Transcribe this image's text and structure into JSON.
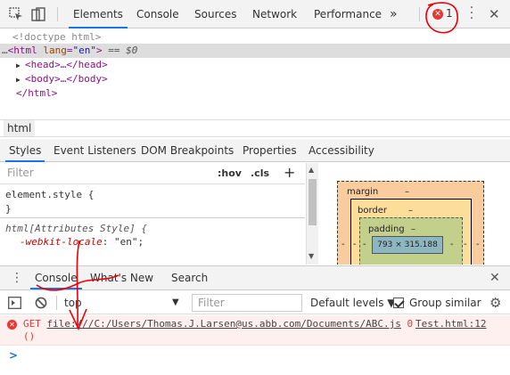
{
  "toolbar": {
    "tabs": [
      {
        "label": "Elements",
        "active": true
      },
      {
        "label": "Console",
        "active": false
      },
      {
        "label": "Sources",
        "active": false
      },
      {
        "label": "Network",
        "active": false
      },
      {
        "label": "Performance",
        "active": false
      }
    ],
    "overflow_label": "»",
    "error_count": "1",
    "icons": [
      "inspect-icon",
      "device-toolbar-icon",
      "more-tabs-icon",
      "error-icon",
      "kebab-menu-icon",
      "close-icon"
    ]
  },
  "dom": {
    "doctype": "<!doctype html>",
    "html_open_tag": "html",
    "html_attr_name": "lang",
    "html_attr_value": "\"en\"",
    "selected_suffix": "== $0",
    "head_line": "<head>…</head>",
    "body_line": "<body>…</body>",
    "html_close": "</html>"
  },
  "breadcrumb": {
    "item": "html"
  },
  "styles_tabs": [
    {
      "label": "Styles",
      "active": true
    },
    {
      "label": "Event Listeners",
      "active": false
    },
    {
      "label": "DOM Breakpoints",
      "active": false
    },
    {
      "label": "Properties",
      "active": false
    },
    {
      "label": "Accessibility",
      "active": false
    }
  ],
  "styles_filter": {
    "placeholder": "Filter",
    "hov": ":hov",
    "cls": ".cls",
    "add": "+"
  },
  "rules": {
    "element_style_open": "element.style {",
    "element_style_close": "}",
    "attr_selector": "html[Attributes Style] {",
    "prop_name": "-webkit-locale",
    "prop_value": ": \"en\";"
  },
  "box_model": {
    "margin_label": "margin",
    "margin_value": "–",
    "border_label": "border",
    "border_value": "–",
    "padding_label": "padding",
    "padding_value": "–",
    "content_size": "793 × 315.188",
    "side_dash": "-"
  },
  "drawer": {
    "tabs": [
      {
        "label": "Console",
        "active": true
      },
      {
        "label": "What's New",
        "active": false
      },
      {
        "label": "Search",
        "active": false
      }
    ],
    "close": "✕"
  },
  "console_bar": {
    "context": "top",
    "filter_placeholder": "Filter",
    "levels": "Default levels ▼",
    "group_similar": "Group similar",
    "group_similar_checked": true
  },
  "console_error": {
    "method": "GET",
    "url": "file:///C:/Users/Thomas.J.Larsen@us.abb.com/Documents/ABC.js",
    "status": "0",
    "source": "Test.html:12",
    "paren": "()"
  },
  "prompt": ">",
  "colors": {
    "accent": "#1a73e8",
    "error": "#e53935",
    "annotation": "#e8000b"
  }
}
